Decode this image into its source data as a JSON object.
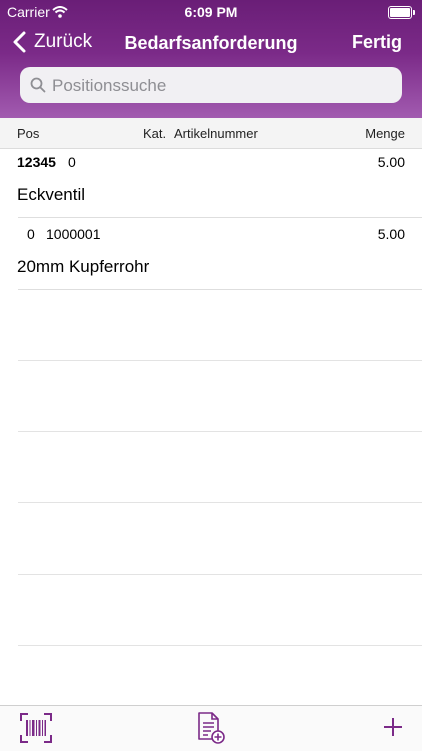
{
  "status_bar": {
    "carrier": "Carrier",
    "time": "6:09 PM"
  },
  "nav": {
    "back_label": "Zurück",
    "title": "Bedarfsanforderung",
    "done_label": "Fertig"
  },
  "search": {
    "placeholder": "Positionssuche",
    "value": ""
  },
  "columns": {
    "pos": "Pos",
    "kat": "Kat.",
    "artikelnummer": "Artikelnummer",
    "menge": "Menge"
  },
  "items": [
    {
      "pos": "12345",
      "kat": "0",
      "artikelnummer": "",
      "menge": "5.00",
      "description": "Eckventil"
    },
    {
      "pos": "",
      "kat": "0",
      "artikelnummer": "1000001",
      "menge": "5.00",
      "description": "20mm Kupferrohr"
    }
  ],
  "toolbar": {
    "icons": [
      "barcode-scan-icon",
      "add-document-icon",
      "plus-icon"
    ]
  },
  "colors": {
    "accent": "#7b2a88",
    "header_top": "#6a1e77",
    "header_bottom": "#a25bb0"
  }
}
